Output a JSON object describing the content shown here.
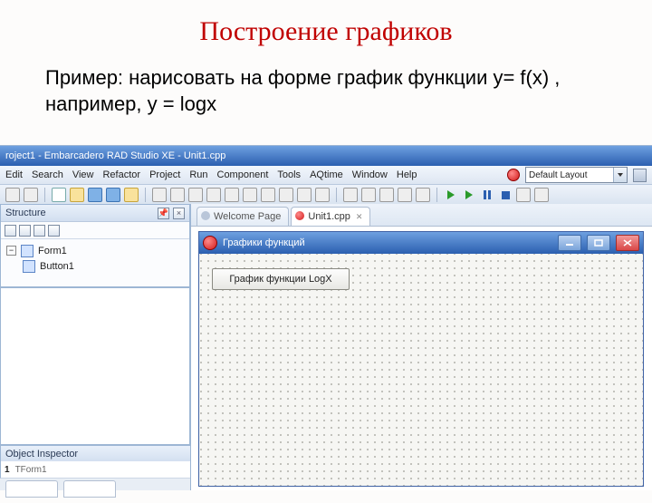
{
  "slide": {
    "title": "Построение графиков",
    "body": "Пример: нарисовать на форме график функции y= f(x) , например, y = logx"
  },
  "ide": {
    "window_title": "roject1 - Embarcadero RAD Studio XE - Unit1.cpp",
    "menu": [
      "Edit",
      "Search",
      "View",
      "Refactor",
      "Project",
      "Run",
      "Component",
      "Tools",
      "AQtime",
      "Window",
      "Help"
    ],
    "layout_dropdown": "Default Layout"
  },
  "structure": {
    "title": "Structure",
    "items": [
      {
        "label": "Form1"
      },
      {
        "label": "Button1"
      }
    ]
  },
  "inspector": {
    "title": "Object Inspector",
    "row_name": "1",
    "row_type": "TForm1"
  },
  "editor": {
    "tabs": [
      {
        "label": "Welcome Page"
      },
      {
        "label": "Unit1.cpp"
      }
    ]
  },
  "designer": {
    "form_caption": "Графики функций",
    "button_caption": "График функции LogX"
  }
}
